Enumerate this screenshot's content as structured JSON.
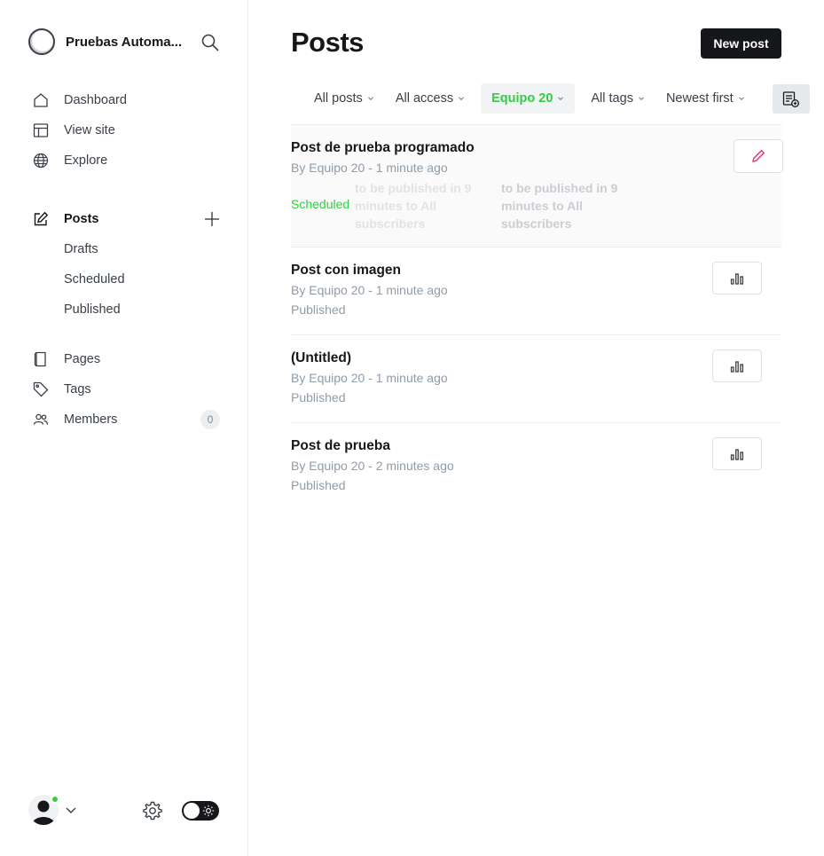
{
  "brand": {
    "name": "Pruebas Automa..."
  },
  "nav": {
    "dashboard": "Dashboard",
    "view_site": "View site",
    "explore": "Explore",
    "posts": "Posts",
    "drafts": "Drafts",
    "scheduled": "Scheduled",
    "published": "Published",
    "pages": "Pages",
    "tags": "Tags",
    "members": "Members",
    "members_count": "0"
  },
  "header": {
    "title": "Posts",
    "new_post": "New post"
  },
  "filters": {
    "type": "All posts",
    "access": "All access",
    "author": "Equipo 20",
    "tags": "All tags",
    "order": "Newest first"
  },
  "posts": [
    {
      "title": "Post de prueba programado",
      "meta": "By Equipo 20 - 1 minute ago",
      "status": "Scheduled",
      "schedule_note": "to be published in 9 minutes to All subscribers"
    },
    {
      "title": "Post con imagen",
      "meta": "By Equipo 20 - 1 minute ago",
      "status": "Published"
    },
    {
      "title": "(Untitled)",
      "meta": "By Equipo 20 - 1 minute ago",
      "status": "Published"
    },
    {
      "title": "Post de prueba",
      "meta": "By Equipo 20 - 2 minutes ago",
      "status": "Published"
    }
  ],
  "colors": {
    "accent_green": "#30cf43",
    "dark": "#15171a",
    "muted": "#8e9cac",
    "edit_pink": "#ef2b7c"
  },
  "icons": {
    "search": "search-icon",
    "dashboard": "home-icon",
    "view_site": "layout-icon",
    "explore": "globe-icon",
    "posts": "edit-icon",
    "pages": "page-icon",
    "tags": "tag-icon",
    "members": "users-icon",
    "settings": "gear-icon",
    "stats": "bar-chart-icon",
    "edit": "pencil-icon"
  }
}
